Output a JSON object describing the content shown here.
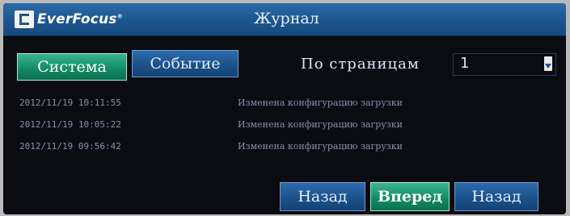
{
  "header": {
    "logo_text": "EverFocus",
    "logo_mark": "®",
    "title": "Журнал"
  },
  "tabs": [
    {
      "label": "Система",
      "active": true
    },
    {
      "label": "Событие",
      "active": false
    }
  ],
  "pagination": {
    "label": "По страницам",
    "current_page": "1"
  },
  "log": [
    {
      "time": "2012/11/19 10:11:55",
      "message": "Изменена конфигурацию загрузки"
    },
    {
      "time": "2012/11/19 10:05:22",
      "message": "Изменена конфигурацию загрузки"
    },
    {
      "time": "2012/11/19 09:56:42",
      "message": "Изменена конфигурацию загрузки"
    }
  ],
  "buttons": {
    "back_left": "Назад",
    "forward": "Вперед",
    "back_right": "Назад"
  },
  "colors": {
    "header_blue": "#1d558f",
    "active_green": "#118a63",
    "background": "#0a0c12"
  },
  "icons": {
    "logo": "everfocus-logo-icon",
    "dropdown": "dropdown-arrow-icon"
  }
}
